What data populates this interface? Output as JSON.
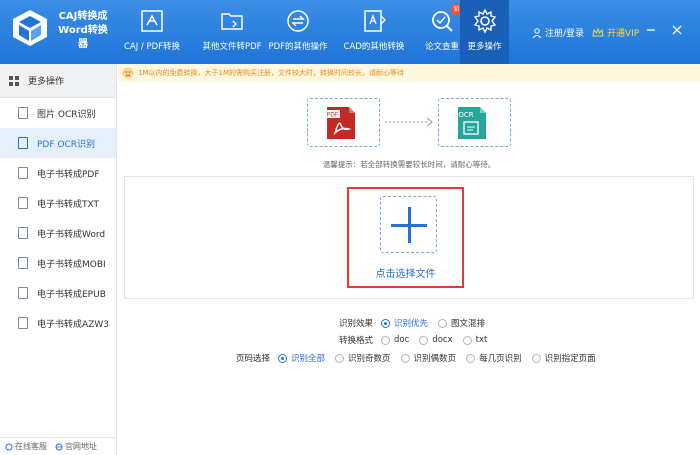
{
  "app": {
    "title": "CAJ转换成Word转换器"
  },
  "tabs": [
    {
      "label": "CAJ / PDF转换",
      "icon": "pdf-convert-icon"
    },
    {
      "label": "其他文件转PDF",
      "icon": "folder-icon"
    },
    {
      "label": "PDF的其他操作",
      "icon": "swap-icon"
    },
    {
      "label": "CAD的其他转换",
      "icon": "cad-icon"
    },
    {
      "label": "论文查重",
      "icon": "check-search-icon",
      "badge": "新"
    },
    {
      "label": "更多操作",
      "icon": "gear-icon",
      "active": true
    }
  ],
  "header_right": {
    "login": "注册/登录",
    "vip": "开通VIP"
  },
  "sidebar": {
    "header": "更多操作",
    "items": [
      {
        "label": "图片 OCR识别"
      },
      {
        "label": "PDF OCR识别",
        "active": true
      },
      {
        "label": "电子书转成PDF"
      },
      {
        "label": "电子书转成TXT"
      },
      {
        "label": "电子书转成Word"
      },
      {
        "label": "电子书转成MOBI"
      },
      {
        "label": "电子书转成EPUB"
      },
      {
        "label": "电子书转成AZW3"
      }
    ],
    "footer": {
      "service": "在线客服",
      "website": "官网地址"
    }
  },
  "notice": "1M以内的免费转换，大于1M的需购买注册，文件较大时，转换时间较长，请耐心等待",
  "flow": {
    "from": "PDF",
    "to": "OCR"
  },
  "hint": "温馨提示：若全部转换需要较长时间，请耐心等待。",
  "upload": {
    "label": "点击选择文件"
  },
  "options": {
    "effect": {
      "label": "识别效果",
      "choices": [
        "识别优先",
        "图文混排"
      ],
      "selected": 0
    },
    "format": {
      "label": "转换格式",
      "choices": [
        "doc",
        "docx",
        "txt"
      ],
      "selected": -1
    },
    "pages": {
      "label": "页码选择",
      "choices": [
        "识别全部",
        "识别奇数页",
        "识别偶数页",
        "每几页识别",
        "识别指定页面"
      ],
      "selected": 0
    }
  },
  "colors": {
    "header": "#1f74d8",
    "accent": "#2a6fd6",
    "highlight": "#e53935",
    "notice": "#f08a1c"
  }
}
